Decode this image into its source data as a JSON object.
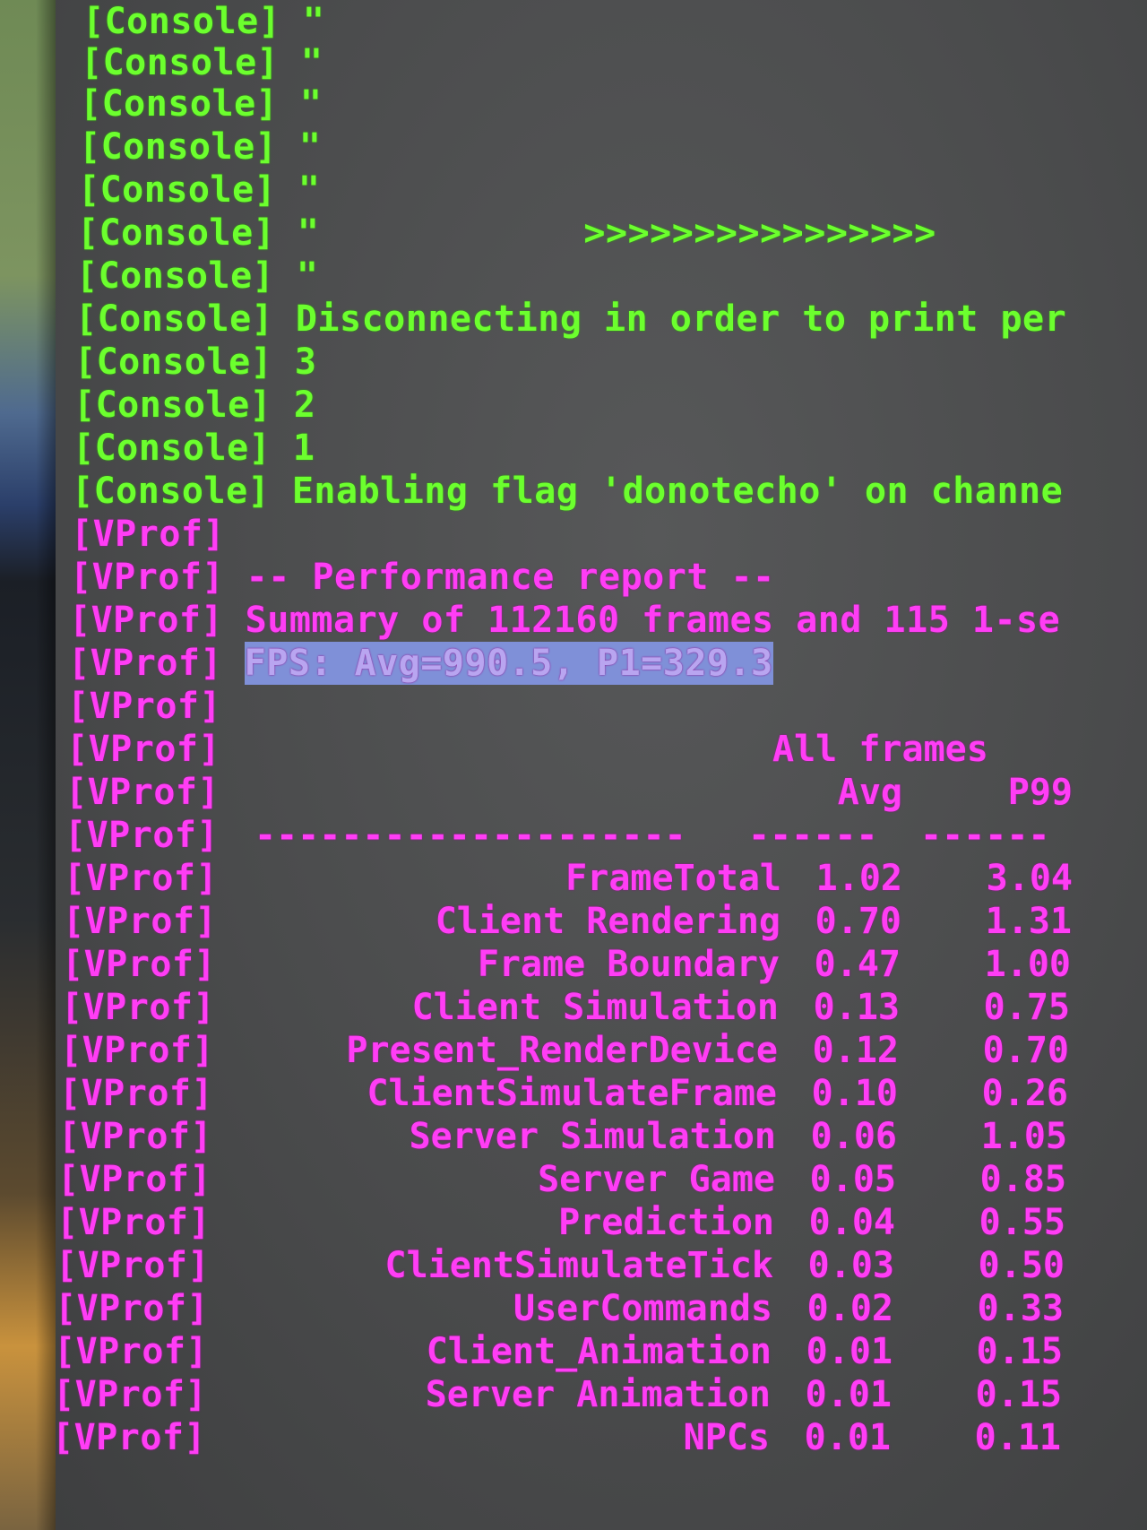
{
  "console_lines": [
    {
      "tag": "[Console]",
      "text": "\""
    },
    {
      "tag": "[Console]",
      "text": "\""
    },
    {
      "tag": "[Console]",
      "text": "\""
    },
    {
      "tag": "[Console]",
      "text": "\""
    },
    {
      "tag": "[Console]",
      "text": "\""
    },
    {
      "tag": "[Console]",
      "text": "\"            >>>>>>>>>>>>>>>>"
    },
    {
      "tag": "[Console]",
      "text": "\""
    },
    {
      "tag": "[Console]",
      "text": "Disconnecting in order to print per"
    },
    {
      "tag": "[Console]",
      "text": "3"
    },
    {
      "tag": "[Console]",
      "text": "2"
    },
    {
      "tag": "[Console]",
      "text": "1"
    },
    {
      "tag": "[Console]",
      "text": "Enabling flag 'donotecho' on channe"
    }
  ],
  "vprof_tag": "[VProf]",
  "report": {
    "title": "-- Performance report --",
    "summary": "Summary of 112160 frames and 115 1-se",
    "fps": "FPS: Avg=990.5, P1=329.3",
    "header_group": "All frames",
    "col_avg": "Avg",
    "col_p99": "P99",
    "divider_name": "--------------------",
    "divider_avg": "------",
    "divider_p99": "------"
  },
  "rows": [
    {
      "name": "FrameTotal",
      "avg": "1.02",
      "p99": "3.04"
    },
    {
      "name": "Client Rendering",
      "avg": "0.70",
      "p99": "1.31"
    },
    {
      "name": "Frame Boundary",
      "avg": "0.47",
      "p99": "1.00"
    },
    {
      "name": "Client Simulation",
      "avg": "0.13",
      "p99": "0.75"
    },
    {
      "name": "Present_RenderDevice",
      "avg": "0.12",
      "p99": "0.70"
    },
    {
      "name": "ClientSimulateFrame",
      "avg": "0.10",
      "p99": "0.26"
    },
    {
      "name": "Server Simulation",
      "avg": "0.06",
      "p99": "1.05"
    },
    {
      "name": "Server Game",
      "avg": "0.05",
      "p99": "0.85"
    },
    {
      "name": "Prediction",
      "avg": "0.04",
      "p99": "0.55"
    },
    {
      "name": "ClientSimulateTick",
      "avg": "0.03",
      "p99": "0.50"
    },
    {
      "name": "UserCommands",
      "avg": "0.02",
      "p99": "0.33"
    },
    {
      "name": "Client_Animation",
      "avg": "0.01",
      "p99": "0.15"
    },
    {
      "name": "Server Animation",
      "avg": "0.01",
      "p99": "0.15"
    },
    {
      "name": "NPCs",
      "avg": "0.01",
      "p99": "0.11"
    }
  ],
  "colors": {
    "console_green": "#6cff2e",
    "vprof_magenta": "#ff3df5",
    "selection": "#7f90d8",
    "background": "#4a4b4c"
  }
}
